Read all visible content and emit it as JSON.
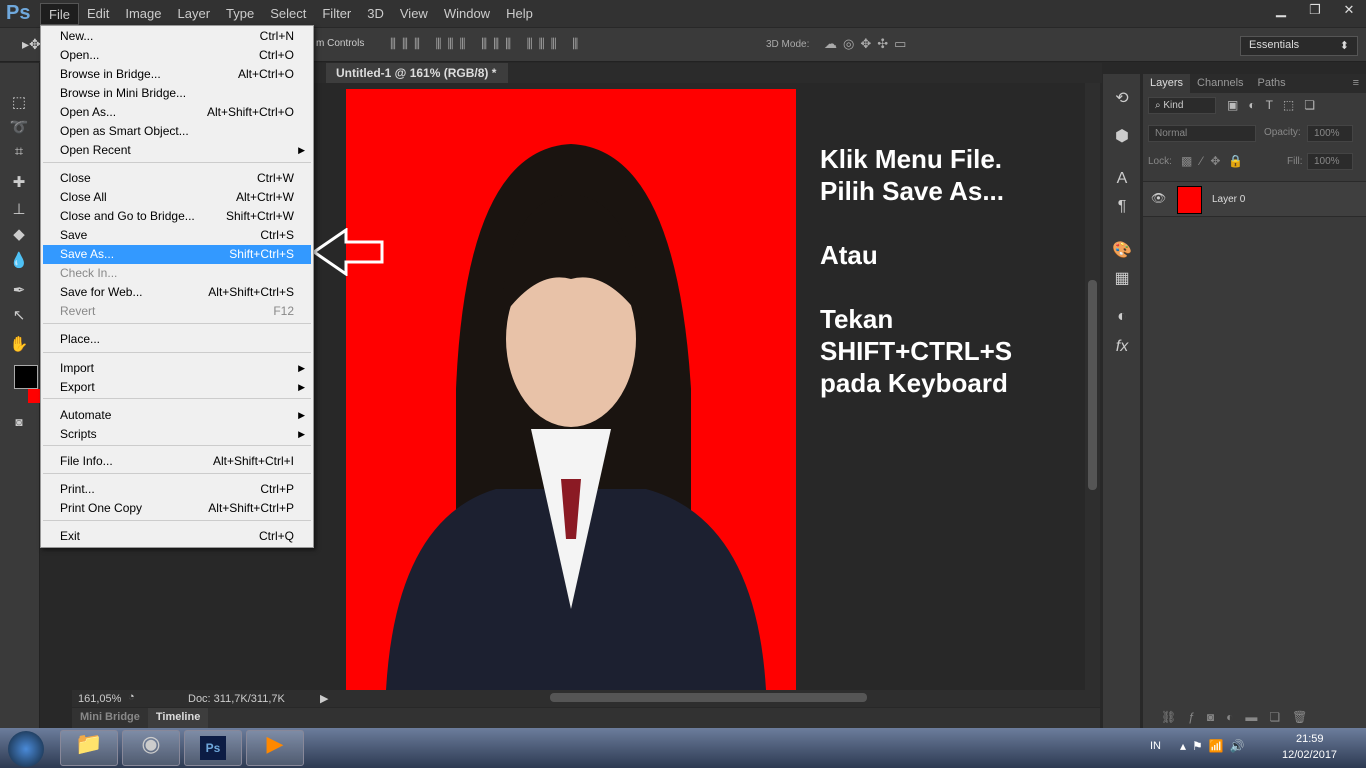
{
  "app": {
    "logo": "Ps"
  },
  "menubar": [
    "File",
    "Edit",
    "Image",
    "Layer",
    "Type",
    "Select",
    "Filter",
    "3D",
    "View",
    "Window",
    "Help"
  ],
  "window_controls": [
    "minimize",
    "restore",
    "close"
  ],
  "options": {
    "controls_label": "m Controls",
    "mode_label": "3D Mode:",
    "workspace": "Essentials"
  },
  "document_tab": {
    "title": "Untitled-1 @ 161% (RGB/8) *",
    "close": "×"
  },
  "file_menu": [
    {
      "label": "New...",
      "shortcut": "Ctrl+N"
    },
    {
      "label": "Open...",
      "shortcut": "Ctrl+O"
    },
    {
      "label": "Browse in Bridge...",
      "shortcut": "Alt+Ctrl+O"
    },
    {
      "label": "Browse in Mini Bridge...",
      "shortcut": ""
    },
    {
      "label": "Open As...",
      "shortcut": "Alt+Shift+Ctrl+O"
    },
    {
      "label": "Open as Smart Object...",
      "shortcut": ""
    },
    {
      "label": "Open Recent",
      "shortcut": "",
      "submenu": true
    },
    {
      "label": "Close",
      "shortcut": "Ctrl+W"
    },
    {
      "label": "Close All",
      "shortcut": "Alt+Ctrl+W"
    },
    {
      "label": "Close and Go to Bridge...",
      "shortcut": "Shift+Ctrl+W"
    },
    {
      "label": "Save",
      "shortcut": "Ctrl+S"
    },
    {
      "label": "Save As...",
      "shortcut": "Shift+Ctrl+S",
      "highlighted": true
    },
    {
      "label": "Check In...",
      "shortcut": "",
      "disabled": true
    },
    {
      "label": "Save for Web...",
      "shortcut": "Alt+Shift+Ctrl+S"
    },
    {
      "label": "Revert",
      "shortcut": "F12",
      "disabled": true
    },
    {
      "label": "Place...",
      "shortcut": ""
    },
    {
      "label": "Import",
      "shortcut": "",
      "submenu": true
    },
    {
      "label": "Export",
      "shortcut": "",
      "submenu": true
    },
    {
      "label": "Automate",
      "shortcut": "",
      "submenu": true
    },
    {
      "label": "Scripts",
      "shortcut": "",
      "submenu": true
    },
    {
      "label": "File Info...",
      "shortcut": "Alt+Shift+Ctrl+I"
    },
    {
      "label": "Print...",
      "shortcut": "Ctrl+P"
    },
    {
      "label": "Print One Copy",
      "shortcut": "Alt+Shift+Ctrl+P"
    },
    {
      "label": "Exit",
      "shortcut": "Ctrl+Q"
    }
  ],
  "instruction": "Klik Menu File.\nPilih Save As...\n\nAtau\n\nTekan\nSHIFT+CTRL+S\npada Keyboard",
  "status": {
    "zoom": "161,05%",
    "doc": "Doc: 311,7K/311,7K"
  },
  "bottom_tabs": [
    "Mini Bridge",
    "Timeline"
  ],
  "layers_panel": {
    "tabs": [
      "Layers",
      "Channels",
      "Paths"
    ],
    "filter": "Kind",
    "blend": "Normal",
    "opacity_label": "Opacity:",
    "opacity": "100%",
    "lock_label": "Lock:",
    "fill_label": "Fill:",
    "fill": "100%",
    "layer_name": "Layer 0"
  },
  "taskbar": {
    "lang": "IN",
    "time": "21:59",
    "date": "12/02/2017"
  },
  "colors": {
    "canvas": "#ff0000",
    "highlight": "#3399ff",
    "foreground": "#000000",
    "background": "#ff0000"
  }
}
